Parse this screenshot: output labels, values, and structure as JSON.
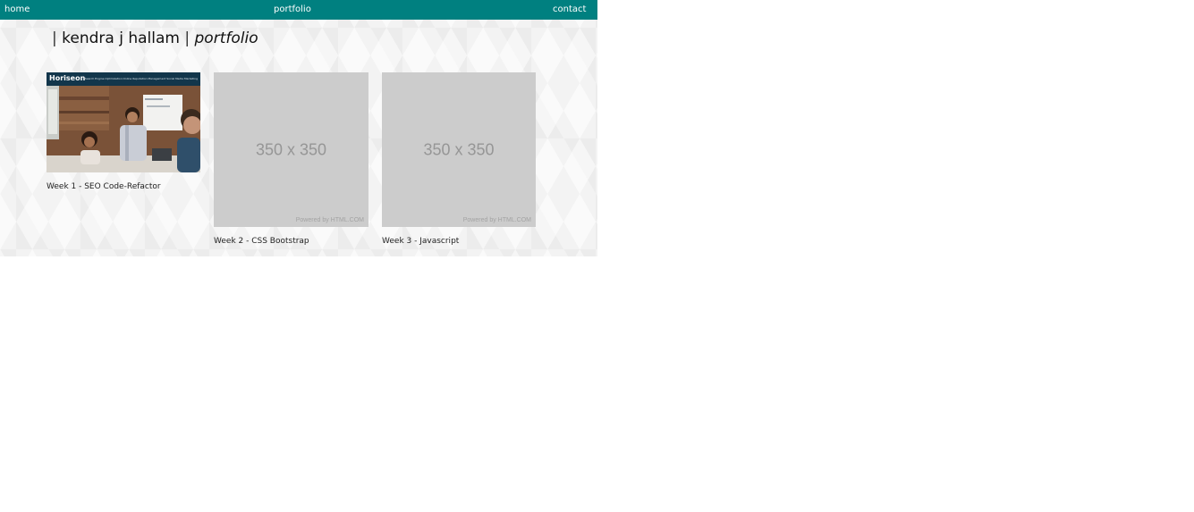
{
  "nav": {
    "home": "home",
    "portfolio": "portfolio",
    "contact": "contact"
  },
  "header": {
    "sep1": "|",
    "name": "kendra j hallam",
    "sep2": "|",
    "subtitle": "portfolio"
  },
  "projects": [
    {
      "caption": "Week 1 - SEO Code-Refactor",
      "thumb": {
        "logo": "Horiseon",
        "nav": "Search Engine Optimization   Online Reputation Management   Social Media Marketing"
      }
    },
    {
      "caption": "Week 2 - CSS Bootstrap",
      "placeholder": "350 x 350",
      "powered": "Powered by HTML.COM"
    },
    {
      "caption": "Week 3 - Javascript",
      "placeholder": "350 x 350",
      "powered": "Powered by HTML.COM"
    }
  ],
  "colors": {
    "navbar": "#008080",
    "placeholder": "#cccccc",
    "horiseon_header": "#12364b"
  }
}
